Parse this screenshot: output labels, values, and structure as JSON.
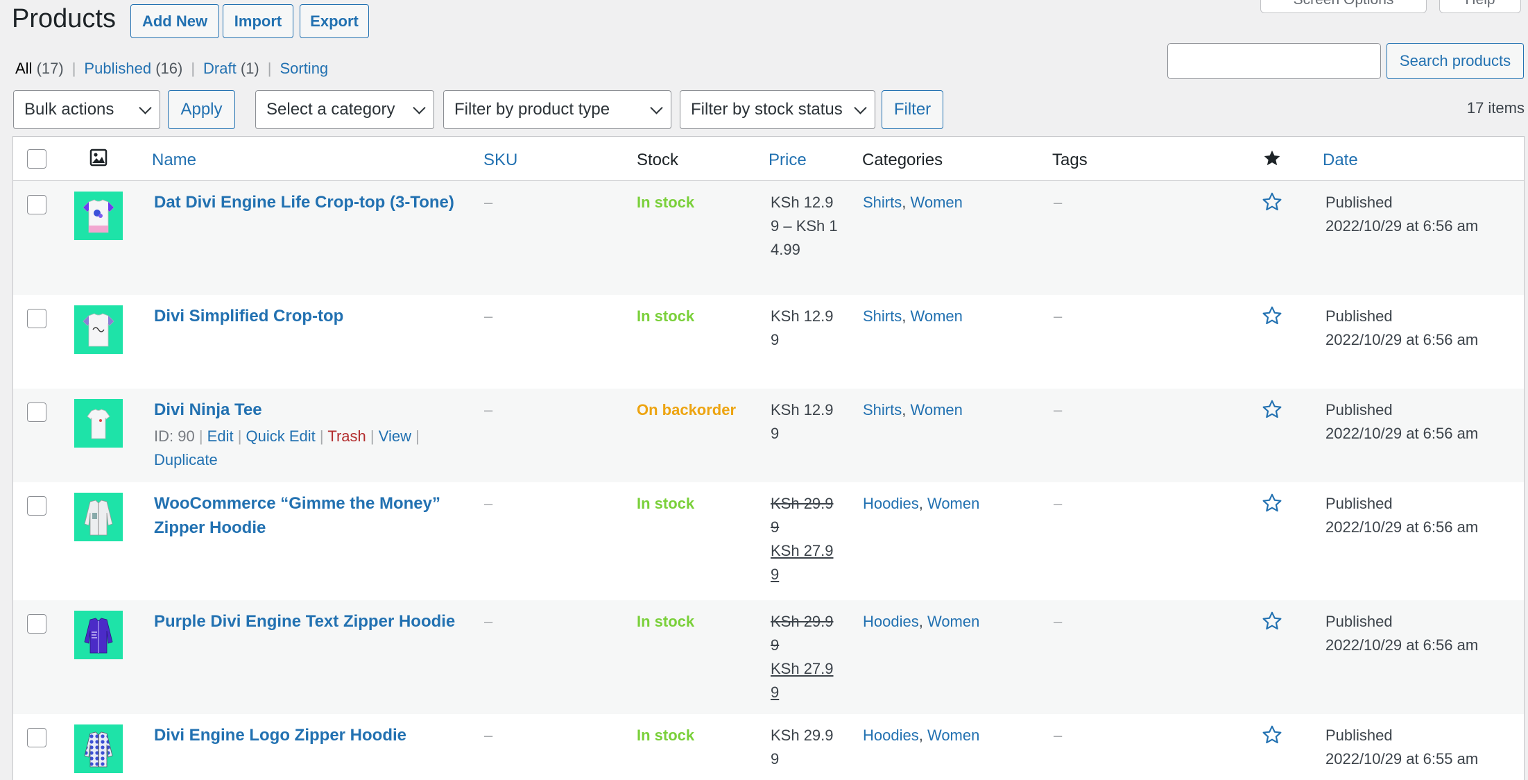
{
  "screen_meta": {
    "options_label": "Screen Options",
    "help_label": "Help"
  },
  "header": {
    "title": "Products",
    "add_new": "Add New",
    "import": "Import",
    "export": "Export"
  },
  "views": [
    {
      "label": "All",
      "count": "(17)"
    },
    {
      "label": "Published",
      "count": "(16)"
    },
    {
      "label": "Draft",
      "count": "(1)"
    },
    {
      "label": "Sorting",
      "count": ""
    }
  ],
  "search": {
    "value": "",
    "button": "Search products"
  },
  "tablenav": {
    "bulk_actions": "Bulk actions",
    "apply": "Apply",
    "category": "Select a category",
    "product_type": "Filter by product type",
    "stock_status": "Filter by stock status",
    "filter": "Filter",
    "items": "17 items"
  },
  "columns": {
    "name": "Name",
    "sku": "SKU",
    "stock": "Stock",
    "price": "Price",
    "categories": "Categories",
    "tags": "Tags",
    "date": "Date"
  },
  "row_actions": {
    "id": "ID: 90",
    "edit": "Edit",
    "quick_edit": "Quick Edit",
    "trash": "Trash",
    "view": "View",
    "duplicate": "Duplicate"
  },
  "products": [
    {
      "name": "Dat Divi Engine Life Crop-top (3-Tone)",
      "sku": "–",
      "stock": "In stock",
      "price_regular": "KSh 12.99 – KSh 14.99",
      "price_sale": "",
      "cat1": "Shirts",
      "cat2": "Women",
      "tags": "–",
      "status": "Published",
      "date": "2022/10/29 at 6:56 am"
    },
    {
      "name": "Divi Simplified Crop-top",
      "sku": "–",
      "stock": "In stock",
      "price_regular": "KSh 12.99",
      "price_sale": "",
      "cat1": "Shirts",
      "cat2": "Women",
      "tags": "–",
      "status": "Published",
      "date": "2022/10/29 at 6:56 am"
    },
    {
      "name": "Divi Ninja Tee",
      "sku": "–",
      "stock": "On backorder",
      "price_regular": "KSh 12.99",
      "price_sale": "",
      "cat1": "Shirts",
      "cat2": "Women",
      "tags": "–",
      "status": "Published",
      "date": "2022/10/29 at 6:56 am"
    },
    {
      "name": "WooCommerce “Gimme the Money” Zipper Hoodie",
      "sku": "–",
      "stock": "In stock",
      "price_regular": "KSh 29.99",
      "price_sale": "KSh 27.99",
      "cat1": "Hoodies",
      "cat2": "Women",
      "tags": "–",
      "status": "Published",
      "date": "2022/10/29 at 6:56 am"
    },
    {
      "name": "Purple Divi Engine Text Zipper Hoodie",
      "sku": "–",
      "stock": "In stock",
      "price_regular": "KSh 29.99",
      "price_sale": "KSh 27.99",
      "cat1": "Hoodies",
      "cat2": "Women",
      "tags": "–",
      "status": "Published",
      "date": "2022/10/29 at 6:56 am"
    },
    {
      "name": "Divi Engine Logo Zipper Hoodie",
      "sku": "–",
      "stock": "In stock",
      "price_regular": "KSh 29.99",
      "price_sale": "",
      "cat1": "Hoodies",
      "cat2": "Women",
      "tags": "–",
      "status": "Published",
      "date": "2022/10/29 at 6:55 am"
    }
  ],
  "colors": {
    "accent": "#2271b1",
    "in_stock": "#7ad03a",
    "backorder": "#eda411",
    "thumb_bg": "#1ee3a8",
    "trash": "#b32d2e"
  }
}
